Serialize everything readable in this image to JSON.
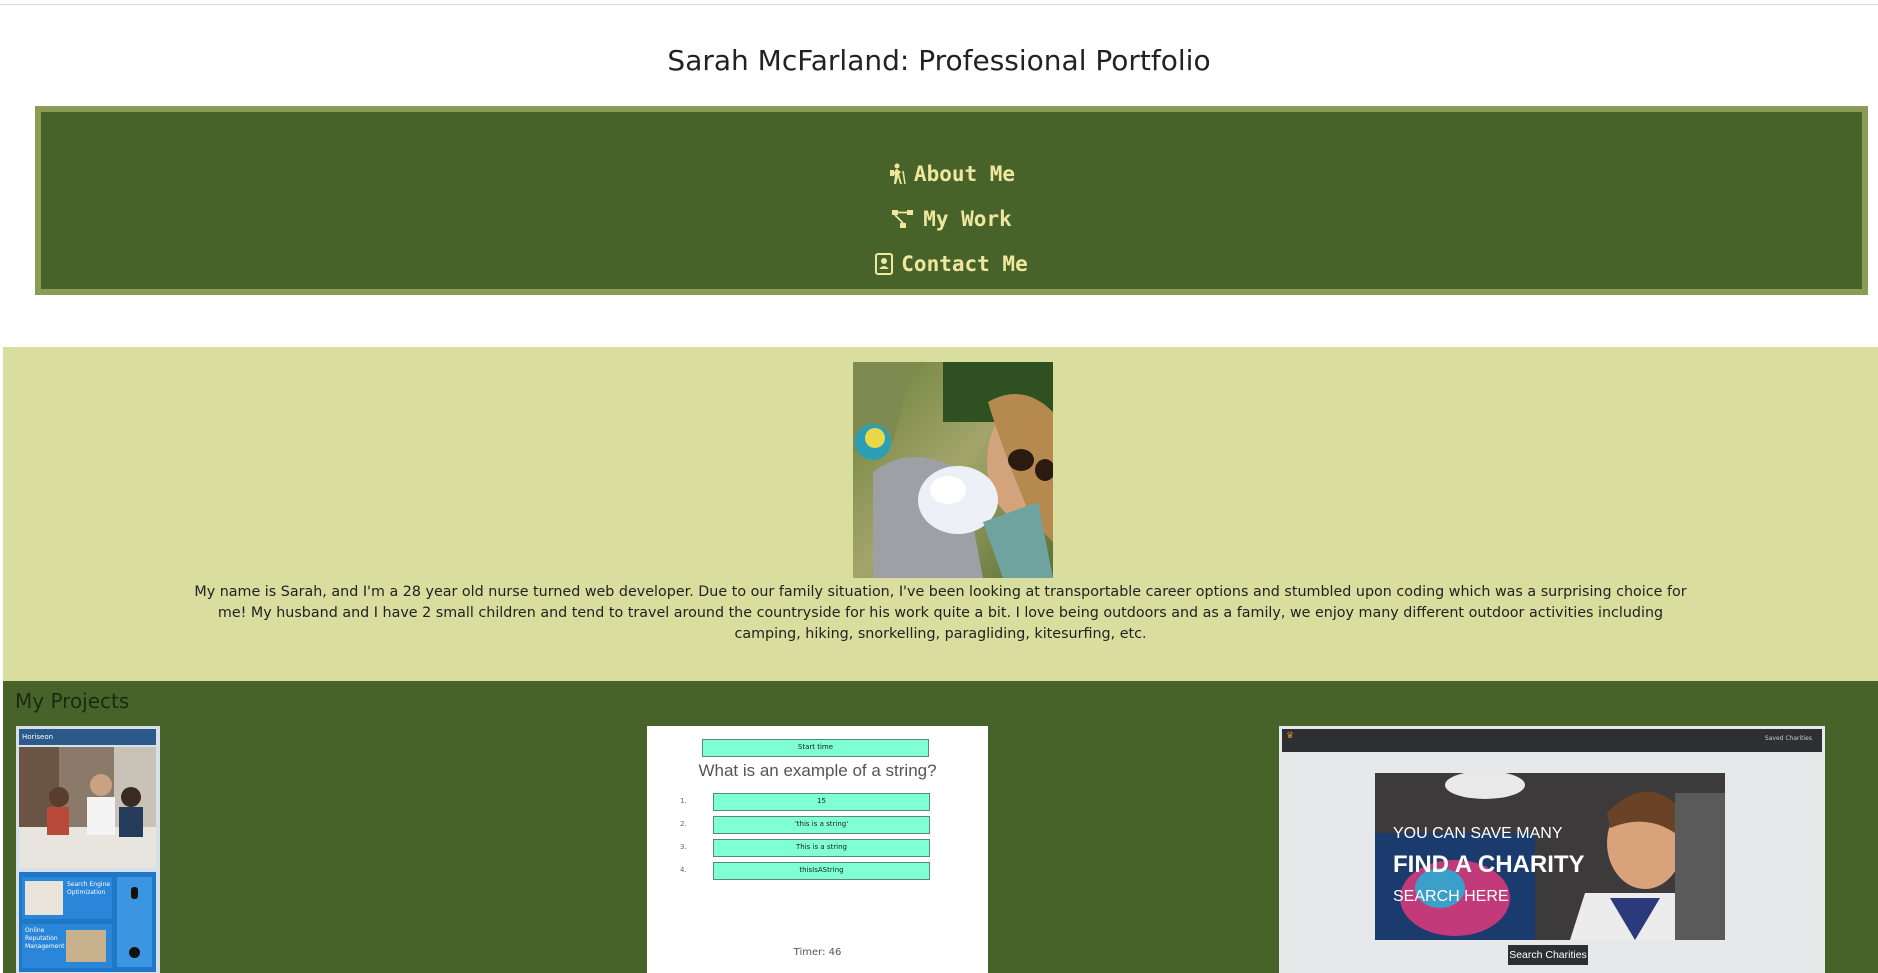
{
  "header": {
    "title": "Sarah McFarland: Professional Portfolio"
  },
  "nav": {
    "items": [
      {
        "label": "About Me",
        "icon": "hiking-icon"
      },
      {
        "label": "My Work",
        "icon": "sitemap-icon"
      },
      {
        "label": "Contact Me",
        "icon": "address-book-icon"
      }
    ]
  },
  "about": {
    "bio": "My name is Sarah, and I'm a 28 year old nurse turned web developer. Due to our family situation, I've been looking at transportable career options and stumbled upon coding which was a surprising choice for me! My husband and I have 2 small children and tend to travel around the countryside for his work quite a bit. I love being outdoors and as a family, we enjoy many different outdoor activities including camping, hiking, snorkelling, paragliding, kitesurfing, etc."
  },
  "projects": {
    "title": "My Projects",
    "horiseon": {
      "brand": "Horiseon",
      "section1": "Search Engine Optimization",
      "section2": "Online Reputation Management"
    },
    "quiz": {
      "start": "Start time",
      "question": "What is an example of a string?",
      "answers": [
        "15",
        "'this is a string'",
        "This is a string",
        "thisIsAString"
      ],
      "numbers": [
        "1.",
        "2.",
        "3.",
        "4."
      ],
      "timer": "Timer: 46"
    },
    "charity": {
      "saved": "Saved Charities",
      "line1": "YOU CAN SAVE MANY",
      "line2": "FIND A CHARITY",
      "line3": "SEARCH HERE",
      "button": "Search Charities"
    }
  },
  "colors": {
    "nav_bg": "#47632a",
    "nav_border": "#8a9c55",
    "nav_text": "#efe79e",
    "about_bg": "#d9dd9e",
    "quiz_button": "#7fffd4"
  }
}
